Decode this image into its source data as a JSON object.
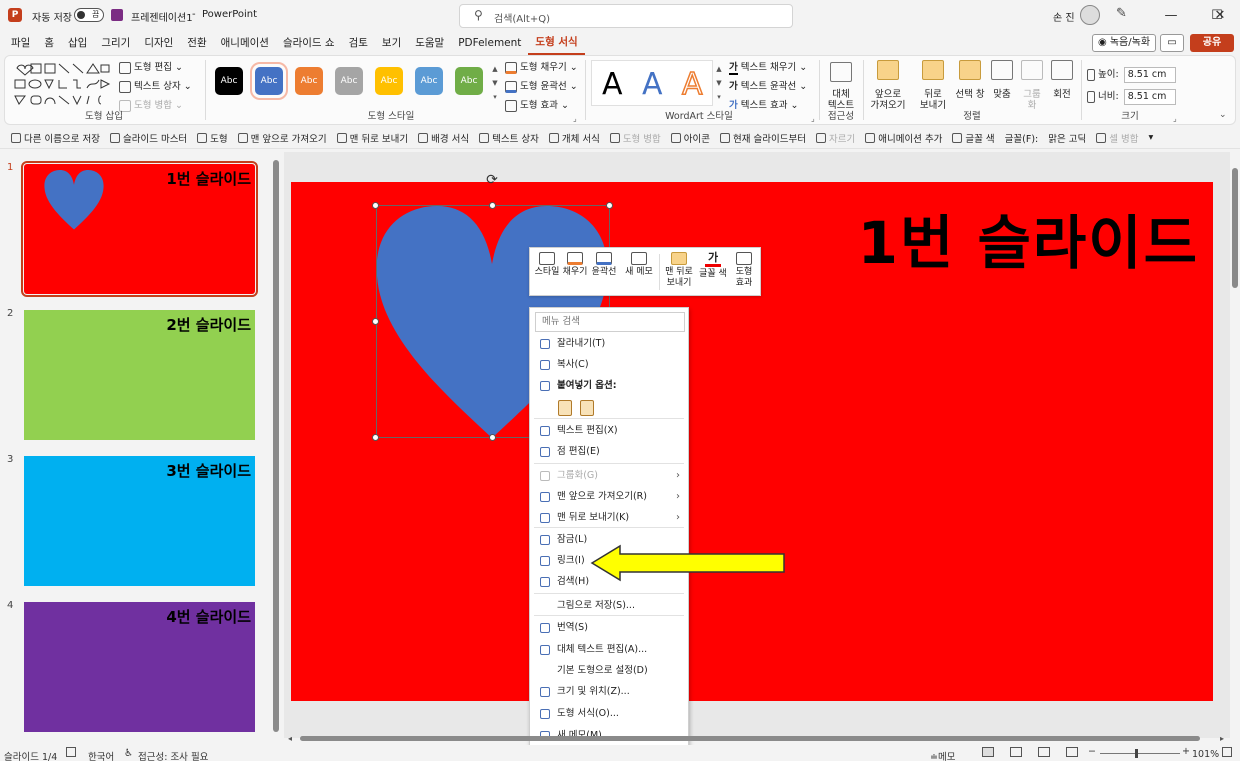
{
  "titlebar": {
    "autosave_label": "자동 저장",
    "autosave_state": "끔",
    "document_title": "프레젠테이션1",
    "separator": "-",
    "app_name": "PowerPoint",
    "search_placeholder": "검색(Alt+Q)",
    "user_name": "손 진",
    "minimize": "—",
    "maximize": "☐",
    "close": "✕"
  },
  "menu_tabs": [
    "파일",
    "홈",
    "삽입",
    "그리기",
    "디자인",
    "전환",
    "애니메이션",
    "슬라이드 쇼",
    "검토",
    "보기",
    "도움말",
    "PDFelement",
    "도형 서식"
  ],
  "active_tab_index": 12,
  "record_label": "◉ 녹음/녹화",
  "share_label": "공유",
  "ribbon": {
    "insert_shapes": {
      "label": "도형 삽입",
      "edit_shape": "도형 편집",
      "text_box": "텍스트 상자",
      "merge_shapes": "도형 병합"
    },
    "shape_styles": {
      "label": "도형 스타일",
      "swatch_text": "Abc",
      "swatch_colors": [
        "#000000",
        "#4472c4",
        "#ed7d31",
        "#a5a5a5",
        "#ffc000",
        "#5b9bd5",
        "#70ad47"
      ],
      "fill": "도형 채우기",
      "outline": "도형 윤곽선",
      "effects": "도형 효과"
    },
    "wordart": {
      "label": "WordArt 스타일",
      "letter": "A",
      "text_fill": "텍스트 채우기",
      "text_outline": "텍스트 윤곽선",
      "text_effects": "텍스트 효과"
    },
    "accessibility": {
      "label": "접근성",
      "alt_text_line1": "대체",
      "alt_text_line2": "텍스트"
    },
    "arrange": {
      "label": "정렬",
      "bring_forward_1": "앞으로",
      "bring_forward_2": "가져오기",
      "send_backward_1": "뒤로",
      "send_backward_2": "보내기",
      "selection_pane": "선택 창",
      "align": "맞춤",
      "group_1": "그룹",
      "group_2": "화",
      "rotate": "회전"
    },
    "size": {
      "label": "크기",
      "height_label": "높이:",
      "height_value": "8.51 cm",
      "width_label": "너비:",
      "width_value": "8.51 cm"
    }
  },
  "quick_access": [
    "다른 이름으로 저장",
    "슬라이드 마스터",
    "도형",
    "맨 앞으로 가져오기",
    "맨 뒤로 보내기",
    "배경 서식",
    "텍스트 상자",
    "개체 서식",
    "도형 병합",
    "아이콘",
    "현재 슬라이드부터",
    "자르기",
    "애니메이션 추가",
    "글꼴 색",
    "글꼴(F):",
    "맑은 고딕",
    "셀 병합"
  ],
  "slides": [
    {
      "num": "1",
      "title": "1번 슬라이드",
      "color": "#ff0000",
      "selected": true
    },
    {
      "num": "2",
      "title": "2번 슬라이드",
      "color": "#92d050",
      "selected": false
    },
    {
      "num": "3",
      "title": "3번 슬라이드",
      "color": "#00b0f0",
      "selected": false
    },
    {
      "num": "4",
      "title": "4번 슬라이드",
      "color": "#7030a0",
      "selected": false
    }
  ],
  "main_slide": {
    "title": "1번 슬라이드",
    "background": "#ff0000",
    "heart_color": "#4472c4"
  },
  "mini_toolbar": {
    "style": "스타일",
    "fill": "채우기",
    "outline": "윤곽선",
    "new_comment": "새 메모",
    "send_back_1": "맨 뒤로",
    "send_back_2": "보내기",
    "font_color": "글꼴 색",
    "font_color_glyph": "가",
    "shape_effects_1": "도형",
    "shape_effects_2": "효과"
  },
  "context_menu": {
    "search_placeholder": "메뉴 검색",
    "items": [
      {
        "label": "잘라내기(T)",
        "disabled": false,
        "submenu": false
      },
      {
        "label": "복사(C)",
        "disabled": false,
        "submenu": false
      },
      {
        "label": "붙여넣기 옵션:",
        "disabled": false,
        "submenu": false
      },
      {
        "label": "텍스트 편집(X)",
        "disabled": false,
        "submenu": false
      },
      {
        "label": "점 편집(E)",
        "disabled": false,
        "submenu": false
      },
      {
        "label": "그룹화(G)",
        "disabled": true,
        "submenu": true
      },
      {
        "label": "맨 앞으로 가져오기(R)",
        "disabled": false,
        "submenu": true
      },
      {
        "label": "맨 뒤로 보내기(K)",
        "disabled": false,
        "submenu": true
      },
      {
        "label": "잠금(L)",
        "disabled": false,
        "submenu": false
      },
      {
        "label": "링크(I)",
        "disabled": false,
        "submenu": false
      },
      {
        "label": "검색(H)",
        "disabled": false,
        "submenu": false
      },
      {
        "label": "그림으로 저장(S)...",
        "disabled": false,
        "submenu": false
      },
      {
        "label": "번역(S)",
        "disabled": false,
        "submenu": false
      },
      {
        "label": "대체 텍스트 편집(A)...",
        "disabled": false,
        "submenu": false
      },
      {
        "label": "기본 도형으로 설정(D)",
        "disabled": false,
        "submenu": false
      },
      {
        "label": "크기 및 위치(Z)...",
        "disabled": false,
        "submenu": false
      },
      {
        "label": "도형 서식(O)...",
        "disabled": false,
        "submenu": false
      },
      {
        "label": "새 메모(M)",
        "disabled": false,
        "submenu": false
      }
    ]
  },
  "annotation": {
    "arrow_color": "#ffff00",
    "points_to": "링크(I)"
  },
  "statusbar": {
    "slide_indicator": "슬라이드 1/4",
    "language": "한국어",
    "accessibility": "접근성: 조사 필요",
    "notes": "≐메모",
    "zoom_level": "101%"
  }
}
